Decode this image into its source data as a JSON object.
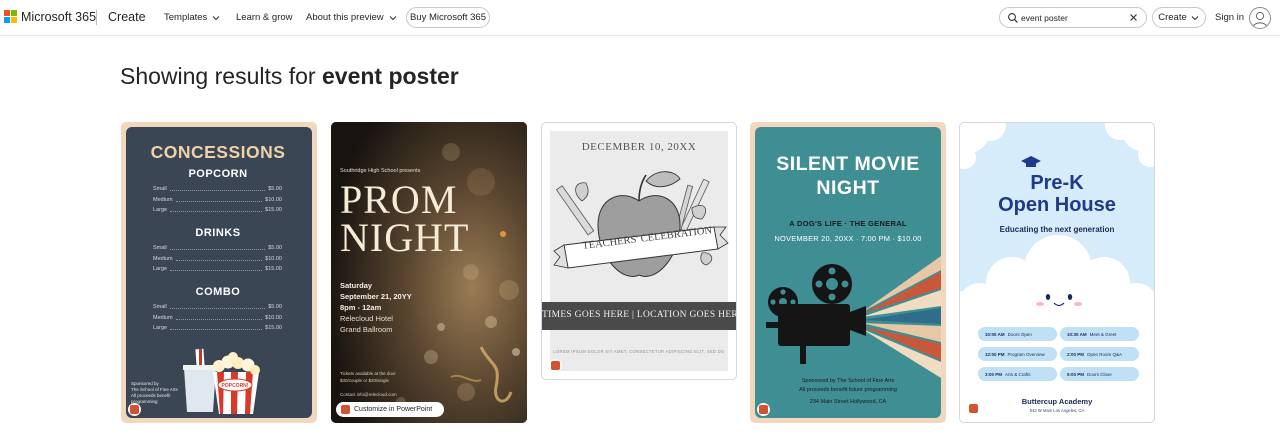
{
  "header": {
    "brand": "Microsoft 365",
    "app": "Create",
    "nav": [
      {
        "label": "Templates",
        "has_dropdown": true
      },
      {
        "label": "Learn & grow",
        "has_dropdown": false
      },
      {
        "label": "About this preview",
        "has_dropdown": true
      }
    ],
    "buy_button": "Buy Microsoft 365",
    "search": {
      "value": "event poster",
      "icon": "search-icon",
      "clear_icon": "close-icon"
    },
    "create_button": "Create",
    "sign_in": "Sign in",
    "logo_colors": [
      "#f25022",
      "#7fba00",
      "#00a4ef",
      "#ffb900"
    ]
  },
  "results": {
    "prefix": "Showing results for ",
    "query": "event poster"
  },
  "templates": [
    {
      "name": "Concessions",
      "title": "CONCESSIONS",
      "sections": [
        {
          "heading": "POPCORN",
          "items": [
            [
              "Small",
              "$5.00"
            ],
            [
              "Medium",
              "$10.00"
            ],
            [
              "Large",
              "$15.00"
            ]
          ]
        },
        {
          "heading": "DRINKS",
          "items": [
            [
              "Small",
              "$5.00"
            ],
            [
              "Medium",
              "$10.00"
            ],
            [
              "Large",
              "$15.00"
            ]
          ]
        },
        {
          "heading": "COMBO",
          "items": [
            [
              "Small",
              "$5.00"
            ],
            [
              "Medium",
              "$10.00"
            ],
            [
              "Large",
              "$15.00"
            ]
          ]
        }
      ],
      "sponsor": [
        "Sponsored by",
        "The School of Fine Arts",
        "All proceeds benefit",
        "programming"
      ],
      "popcorn_label": "POPCORN!",
      "colors": {
        "board": "#3a4654",
        "frame": "#f1d7bd",
        "accent": "#f0d2aa"
      }
    },
    {
      "name": "Prom Night",
      "presenter": "Southridge High School presents",
      "line1": "PROM",
      "line2": "NIGHT",
      "day": "Saturday",
      "date": "September 21, 20YY",
      "time": "8pm - 12am",
      "venue": "Relecloud Hotel",
      "room": "Grand Ballroom",
      "tickets": [
        "Tickets available at the door",
        "$30/couple or $20/single"
      ],
      "contact": "Contact info@relecloud.com",
      "customize_button": "Customize in PowerPoint"
    },
    {
      "name": "Teachers' Celebration",
      "date": "DECEMBER 10, 20XX",
      "ribbon": "TEACHERS' CELEBRATION",
      "time_location": "TIMES GOES HERE | LOCATION GOES HERE",
      "footer": "LOREM IPSUM DOLOR SIT AMET, CONSECTETUR ADIPISCING ELIT, SED DO"
    },
    {
      "name": "Silent Movie Night",
      "line1": "SILENT MOVIE",
      "line2": "NIGHT",
      "subtitle": "A DOG'S LIFE · THE GENERAL",
      "date": "NOVEMBER 20, 20XX · 7:00 PM · $10.00",
      "sponsor": "Sponsored by The School of Fine Arts",
      "proceeds": "All proceeds benefit future programming",
      "address": "234 Main Street Hollywood, CA",
      "colors": {
        "panel": "#3e8e94",
        "frame": "#f1d7bd"
      }
    },
    {
      "name": "Pre-K Open House",
      "line1": "Pre-K",
      "line2": "Open House",
      "subtitle": "Educating the next generation",
      "schedule": [
        {
          "time": "10:00 AM",
          "event": "Doors Open"
        },
        {
          "time": "10:30 AM",
          "event": "Meet & Greet"
        },
        {
          "time": "12:00 PM",
          "event": "Program Overview"
        },
        {
          "time": "2:00 PM",
          "event": "Open Room Q&A"
        },
        {
          "time": "3:00 PM",
          "event": "Arts & Crafts"
        },
        {
          "time": "5:00 PM",
          "event": "Doors Close"
        }
      ],
      "academy": "Buttercup Academy",
      "address": "543 W Main Los Angeles, CA"
    }
  ]
}
